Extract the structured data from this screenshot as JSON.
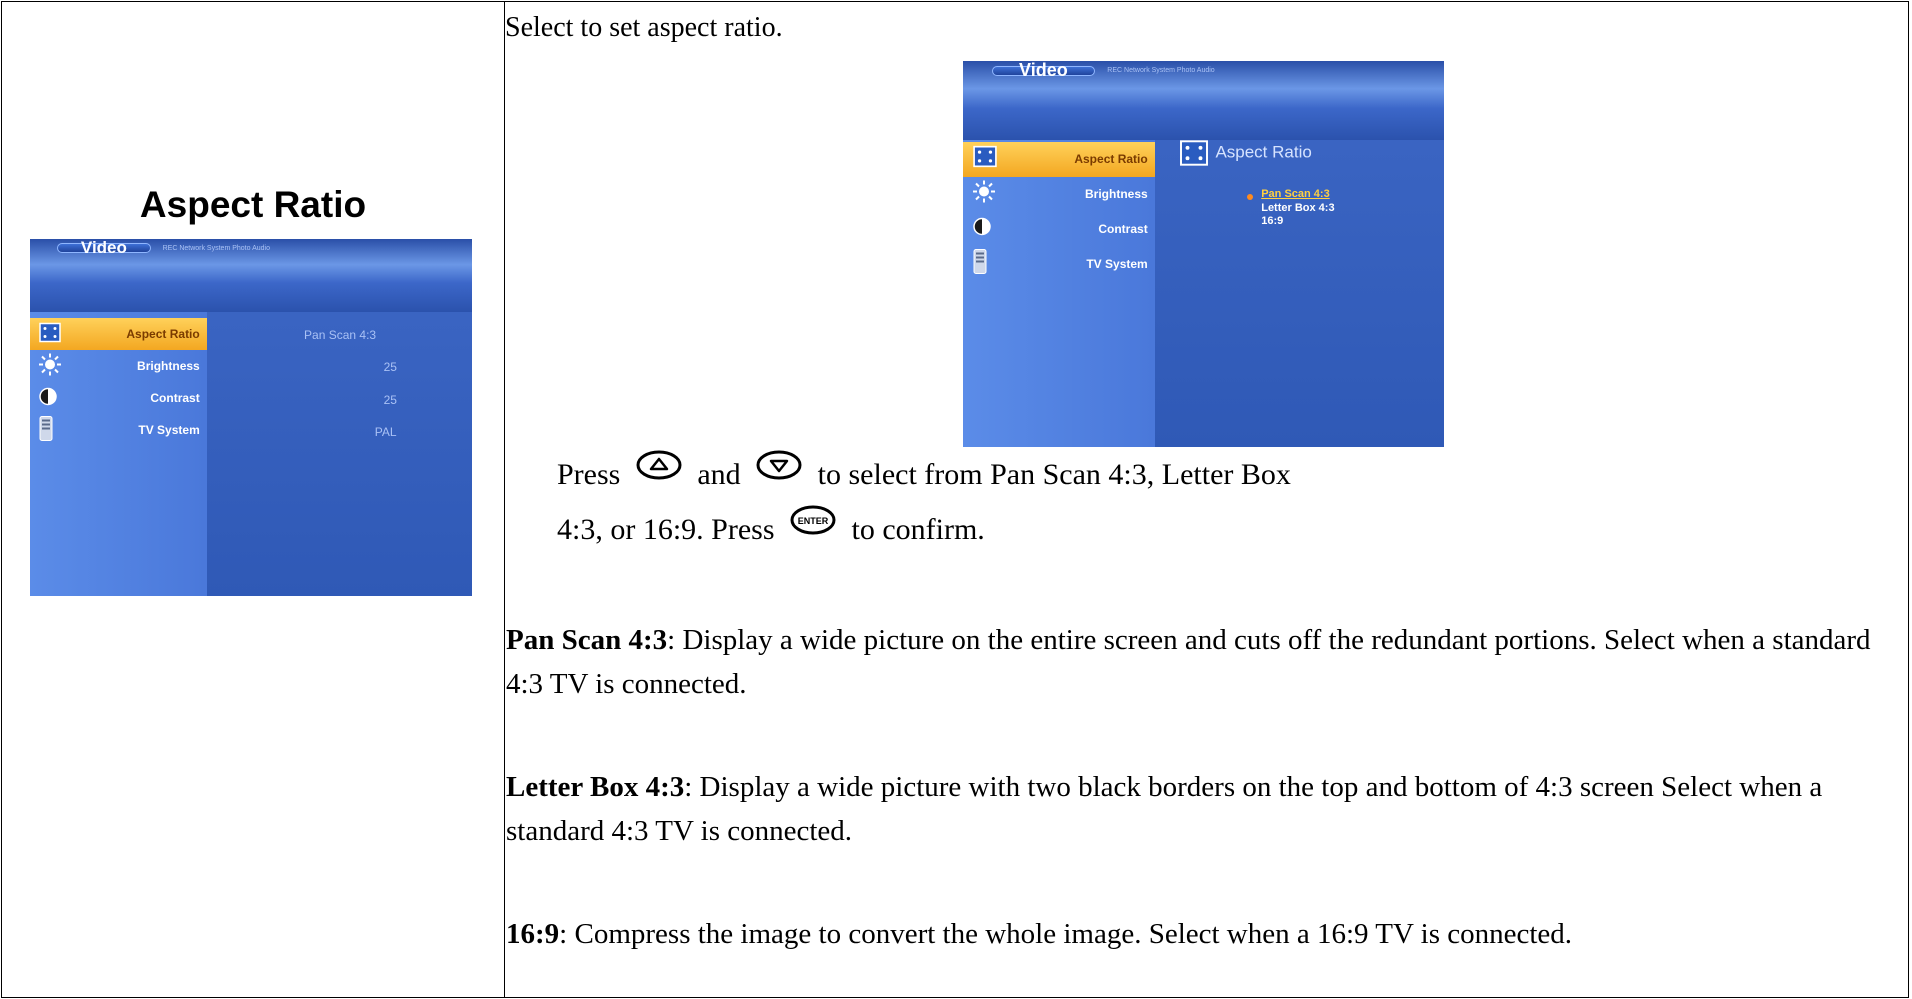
{
  "left": {
    "heading": "Aspect Ratio",
    "screen": {
      "tab_active": "Video",
      "tabs_other": "REC    Network    System    Photo    Audio",
      "menu": [
        {
          "label": "Aspect Ratio",
          "value": "Pan Scan 4:3",
          "icon": "aspect-ratio-icon",
          "selected": true
        },
        {
          "label": "Brightness",
          "value": "25",
          "icon": "brightness-icon",
          "selected": false
        },
        {
          "label": "Contrast",
          "value": "25",
          "icon": "contrast-icon",
          "selected": false
        },
        {
          "label": "TV System",
          "value": "PAL",
          "icon": "tv-system-icon",
          "selected": false
        }
      ]
    }
  },
  "right": {
    "intro": "Select to set aspect ratio.",
    "screen": {
      "tab_active": "Video",
      "tabs_other": "REC    Network    System    Photo    Audio",
      "menu": [
        {
          "label": "Aspect Ratio",
          "icon": "aspect-ratio-icon",
          "selected": true
        },
        {
          "label": "Brightness",
          "icon": "brightness-icon",
          "selected": false
        },
        {
          "label": "Contrast",
          "icon": "contrast-icon",
          "selected": false
        },
        {
          "label": "TV System",
          "icon": "tv-system-icon",
          "selected": false
        }
      ],
      "panel_title": "Aspect Ratio",
      "options": [
        "Pan Scan 4:3",
        "Letter Box 4:3",
        "16:9"
      ]
    },
    "press": {
      "press": "Press",
      "and": "and",
      "select_from": "to select from Pan Scan 4:3, Letter Box",
      "line2_start": "4:3, or 16:9. Press",
      "confirm": "to confirm.",
      "enter_label": "ENTER"
    },
    "definitions": [
      {
        "term": "Pan Scan 4:3",
        "text": ": Display a wide picture on the entire screen and cuts off the redundant portions. Select when a standard 4:3 TV is connected."
      },
      {
        "term": "Letter Box 4:3",
        "text": ": Display a wide picture with two black borders on the top and bottom of 4:3 screen Select when a standard 4:3 TV is connected."
      },
      {
        "term": "16:9",
        "text": ": Compress the image to convert the whole image. Select when a 16:9 TV is connected."
      }
    ]
  }
}
